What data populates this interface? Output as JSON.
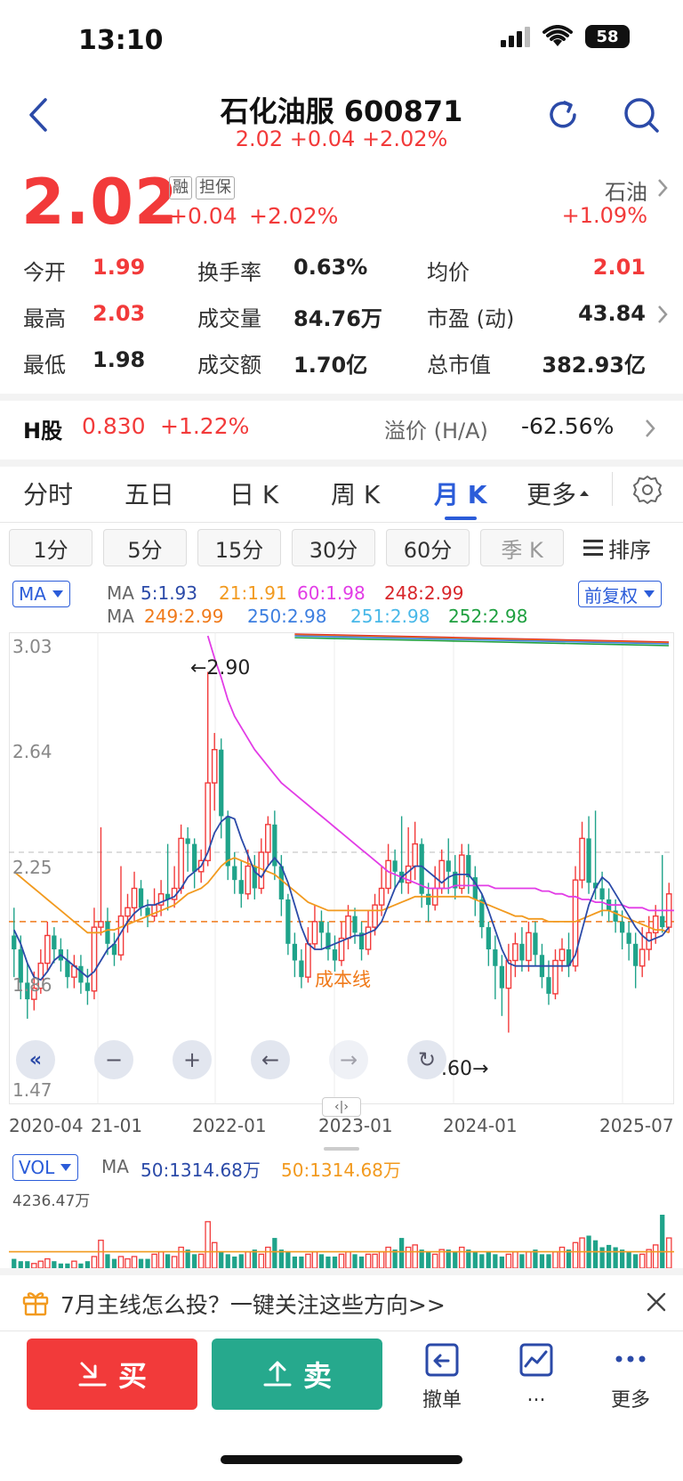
{
  "status_bar": {
    "time": "13:10",
    "battery": "58"
  },
  "header": {
    "title": "石化油服 600871",
    "subtitle": "2.02 +0.04 +2.02%"
  },
  "quote": {
    "price": "2.02",
    "tag_margin": "融",
    "tag_collateral": "担保",
    "change": "+0.04",
    "change_pct": "+2.02%",
    "sector_name": "石油",
    "sector_change": "+1.09%"
  },
  "stats": {
    "open_label": "今开",
    "open": "1.99",
    "turnover_label": "换手率",
    "turnover": "0.63%",
    "avg_label": "均价",
    "avg": "2.01",
    "high_label": "最高",
    "high": "2.03",
    "volume_label": "成交量",
    "volume": "84.76万",
    "pe_label": "市盈 (动)",
    "pe": "43.84",
    "low_label": "最低",
    "low": "1.98",
    "amount_label": "成交额",
    "amount": "1.70亿",
    "mcap_label": "总市值",
    "mcap": "382.93亿"
  },
  "hshare": {
    "label": "H股",
    "price": "0.830",
    "change_pct": "+1.22%",
    "premium_label": "溢价 (H/A)",
    "premium": "-62.56%"
  },
  "tabs": [
    "分时",
    "五日",
    "日 K",
    "周 K",
    "月 K",
    "更多"
  ],
  "active_tab": "月 K",
  "intervals": [
    "1分",
    "5分",
    "15分",
    "30分",
    "60分",
    "季 K",
    "排序"
  ],
  "ma_panel": {
    "selector": "MA",
    "right_selector": "前复权",
    "line1": {
      "prefix": "MA",
      "ma5": "5:1.93",
      "ma21": "21:1.91",
      "ma60": "60:1.98",
      "ma248": "248:2.99"
    },
    "line2": {
      "prefix": "MA",
      "ma249": "249:2.99",
      "ma250": "250:2.98",
      "ma251": "251:2.98",
      "ma252": "252:2.98"
    },
    "colors": {
      "ma5": "#2b4aa8",
      "ma21": "#f29a1f",
      "ma60": "#e23ce6",
      "ma248": "#d8262a",
      "ma249": "#f07a1a",
      "ma250": "#3d7fe0",
      "ma251": "#48b8e8",
      "ma252": "#1fa040"
    }
  },
  "vol_panel": {
    "selector": "VOL",
    "prefix": "MA",
    "ma50_blue": "50:1314.68万",
    "ma50_orange": "50:1314.68万",
    "max_label": "4236.47万"
  },
  "chart_data": {
    "type": "candlestick",
    "y_ticks": [
      "3.03",
      "2.64",
      "2.25",
      "1.86",
      "1.47"
    ],
    "ylim": [
      1.47,
      3.03
    ],
    "x_ticks": [
      "2020-04",
      "21-01",
      "2022-01",
      "2023-01",
      "2024-01",
      "2025-07"
    ],
    "cost_line_label": "成本线",
    "cost_line_value": 2.0,
    "dashed_line_value": 2.25,
    "max_annotation": "←2.90",
    "min_annotation": "1.60→",
    "max_value": 2.9,
    "min_value": 1.6,
    "candles": [
      [
        1.95,
        1.9,
        2.05,
        1.8
      ],
      [
        1.9,
        1.78,
        1.95,
        1.72
      ],
      [
        1.78,
        1.72,
        1.85,
        1.65
      ],
      [
        1.72,
        1.76,
        1.82,
        1.68
      ],
      [
        1.76,
        1.85,
        1.9,
        1.74
      ],
      [
        1.85,
        1.95,
        2.0,
        1.82
      ],
      [
        1.95,
        1.9,
        1.98,
        1.85
      ],
      [
        1.9,
        1.86,
        1.94,
        1.82
      ],
      [
        1.86,
        1.8,
        1.9,
        1.76
      ],
      [
        1.8,
        1.84,
        1.88,
        1.76
      ],
      [
        1.84,
        1.78,
        1.88,
        1.74
      ],
      [
        1.78,
        1.75,
        1.83,
        1.7
      ],
      [
        1.75,
        1.98,
        2.05,
        1.72
      ],
      [
        1.98,
        2.0,
        2.34,
        1.95
      ],
      [
        2.0,
        1.92,
        2.05,
        1.88
      ],
      [
        1.92,
        1.88,
        1.96,
        1.84
      ],
      [
        1.88,
        2.02,
        2.2,
        1.86
      ],
      [
        2.02,
        2.05,
        2.1,
        1.96
      ],
      [
        2.05,
        2.12,
        2.18,
        2.0
      ],
      [
        2.12,
        2.05,
        2.15,
        2.02
      ],
      [
        2.05,
        2.02,
        2.08,
        1.98
      ],
      [
        2.02,
        2.06,
        2.12,
        2.0
      ],
      [
        2.06,
        2.1,
        2.15,
        2.02
      ],
      [
        2.1,
        2.08,
        2.28,
        2.04
      ],
      [
        2.08,
        2.12,
        2.2,
        2.05
      ],
      [
        2.12,
        2.3,
        2.35,
        2.1
      ],
      [
        2.3,
        2.28,
        2.34,
        2.18
      ],
      [
        2.28,
        2.18,
        2.3,
        2.12
      ],
      [
        2.18,
        2.22,
        2.26,
        2.14
      ],
      [
        2.22,
        2.5,
        2.9,
        2.2
      ],
      [
        2.5,
        2.62,
        2.68,
        2.4
      ],
      [
        2.62,
        2.38,
        2.66,
        2.3
      ],
      [
        2.38,
        2.2,
        2.4,
        2.15
      ],
      [
        2.2,
        2.15,
        2.25,
        2.1
      ],
      [
        2.15,
        2.1,
        2.22,
        2.05
      ],
      [
        2.1,
        2.2,
        2.26,
        2.08
      ],
      [
        2.2,
        2.12,
        2.24,
        2.08
      ],
      [
        2.12,
        2.25,
        2.3,
        2.1
      ],
      [
        2.25,
        2.35,
        2.38,
        2.2
      ],
      [
        2.35,
        2.2,
        2.4,
        2.15
      ],
      [
        2.2,
        2.08,
        2.24,
        2.02
      ],
      [
        2.08,
        1.92,
        2.1,
        1.88
      ],
      [
        1.92,
        1.86,
        1.96,
        1.8
      ],
      [
        1.86,
        1.8,
        1.9,
        1.76
      ],
      [
        1.8,
        1.92,
        1.98,
        1.78
      ],
      [
        1.92,
        2.0,
        2.06,
        1.9
      ],
      [
        2.0,
        1.96,
        2.04,
        1.9
      ],
      [
        1.96,
        1.9,
        2.0,
        1.86
      ],
      [
        1.9,
        1.86,
        1.95,
        1.82
      ],
      [
        1.86,
        1.94,
        2.0,
        1.84
      ],
      [
        1.94,
        2.02,
        2.06,
        1.9
      ],
      [
        2.02,
        1.96,
        2.05,
        1.92
      ],
      [
        1.96,
        1.9,
        2.0,
        1.86
      ],
      [
        1.9,
        1.98,
        2.04,
        1.88
      ],
      [
        1.98,
        2.06,
        2.1,
        1.95
      ],
      [
        2.06,
        2.12,
        2.2,
        2.02
      ],
      [
        2.12,
        2.22,
        2.28,
        2.1
      ],
      [
        2.22,
        2.18,
        2.26,
        2.12
      ],
      [
        2.18,
        2.14,
        2.38,
        2.1
      ],
      [
        2.14,
        2.2,
        2.34,
        2.1
      ],
      [
        2.2,
        2.28,
        2.36,
        2.15
      ],
      [
        2.28,
        2.1,
        2.3,
        2.05
      ],
      [
        2.1,
        2.06,
        2.14,
        2.0
      ],
      [
        2.06,
        2.12,
        2.2,
        2.04
      ],
      [
        2.12,
        2.22,
        2.26,
        2.1
      ],
      [
        2.22,
        2.18,
        2.3,
        2.1
      ],
      [
        2.18,
        2.12,
        2.24,
        2.08
      ],
      [
        2.12,
        2.24,
        2.28,
        2.1
      ],
      [
        2.24,
        2.16,
        2.28,
        2.1
      ],
      [
        2.16,
        2.08,
        2.2,
        2.02
      ],
      [
        2.08,
        1.98,
        2.1,
        1.94
      ],
      [
        1.98,
        1.9,
        2.0,
        1.84
      ],
      [
        1.9,
        1.84,
        1.95,
        1.72
      ],
      [
        1.84,
        1.76,
        1.88,
        1.66
      ],
      [
        1.76,
        1.86,
        1.92,
        1.6
      ],
      [
        1.86,
        1.92,
        1.96,
        1.8
      ],
      [
        1.92,
        1.86,
        1.98,
        1.82
      ],
      [
        1.86,
        1.96,
        2.0,
        1.82
      ],
      [
        1.96,
        1.88,
        2.0,
        1.84
      ],
      [
        1.88,
        1.8,
        1.92,
        1.76
      ],
      [
        1.8,
        1.74,
        1.86,
        1.7
      ],
      [
        1.74,
        1.86,
        1.9,
        1.72
      ],
      [
        1.86,
        1.9,
        1.94,
        1.82
      ],
      [
        1.9,
        1.84,
        1.96,
        1.8
      ],
      [
        1.84,
        2.15,
        2.2,
        1.82
      ],
      [
        2.15,
        2.3,
        2.36,
        2.12
      ],
      [
        2.3,
        2.14,
        2.38,
        2.1
      ],
      [
        2.14,
        2.12,
        2.4,
        2.08
      ],
      [
        2.12,
        2.08,
        2.18,
        2.02
      ],
      [
        2.08,
        2.04,
        2.12,
        2.0
      ],
      [
        2.04,
        2.0,
        2.08,
        1.96
      ],
      [
        2.0,
        1.96,
        2.04,
        1.9
      ],
      [
        1.96,
        1.92,
        2.0,
        1.86
      ],
      [
        1.92,
        1.84,
        1.96,
        1.76
      ],
      [
        1.84,
        1.9,
        1.98,
        1.8
      ],
      [
        1.9,
        1.96,
        2.02,
        1.86
      ],
      [
        1.96,
        2.02,
        2.06,
        1.92
      ],
      [
        2.02,
        1.98,
        2.24,
        1.96
      ],
      [
        1.98,
        2.1,
        2.14,
        1.96
      ]
    ],
    "ma5": [
      1.97,
      1.92,
      1.85,
      1.8,
      1.79,
      1.82,
      1.86,
      1.88,
      1.86,
      1.84,
      1.82,
      1.8,
      1.82,
      1.86,
      1.9,
      1.92,
      1.96,
      2.0,
      2.03,
      2.05,
      2.06,
      2.06,
      2.07,
      2.08,
      2.09,
      2.12,
      2.16,
      2.18,
      2.2,
      2.25,
      2.32,
      2.36,
      2.38,
      2.37,
      2.3,
      2.24,
      2.18,
      2.16,
      2.2,
      2.23,
      2.2,
      2.14,
      2.06,
      1.98,
      1.92,
      1.9,
      1.9,
      1.91,
      1.92,
      1.93,
      1.94,
      1.95,
      1.95,
      1.96,
      1.97,
      2.0,
      2.06,
      2.12,
      2.16,
      2.18,
      2.2,
      2.2,
      2.18,
      2.16,
      2.14,
      2.16,
      2.17,
      2.17,
      2.17,
      2.14,
      2.1,
      2.04,
      1.97,
      1.9,
      1.85,
      1.84,
      1.84,
      1.84,
      1.84,
      1.84,
      1.84,
      1.84,
      1.84,
      1.84,
      1.88,
      1.97,
      2.06,
      2.12,
      2.16,
      2.14,
      2.1,
      2.06,
      2.02,
      1.98,
      1.95,
      1.93,
      1.94,
      1.95,
      1.98
    ],
    "ma21": [
      2.18,
      2.16,
      2.14,
      2.12,
      2.1,
      2.08,
      2.06,
      2.04,
      2.02,
      2.0,
      1.98,
      1.96,
      1.96,
      1.96,
      1.97,
      1.97,
      1.98,
      1.99,
      2.0,
      2.01,
      2.02,
      2.03,
      2.04,
      2.05,
      2.06,
      2.08,
      2.1,
      2.11,
      2.12,
      2.14,
      2.17,
      2.2,
      2.22,
      2.23,
      2.22,
      2.21,
      2.2,
      2.19,
      2.18,
      2.17,
      2.15,
      2.13,
      2.11,
      2.09,
      2.07,
      2.06,
      2.05,
      2.04,
      2.04,
      2.04,
      2.04,
      2.04,
      2.04,
      2.04,
      2.04,
      2.04,
      2.05,
      2.06,
      2.07,
      2.08,
      2.09,
      2.09,
      2.09,
      2.09,
      2.09,
      2.09,
      2.09,
      2.09,
      2.09,
      2.08,
      2.07,
      2.06,
      2.05,
      2.04,
      2.03,
      2.02,
      2.02,
      2.01,
      2.01,
      2.01,
      2.0,
      2.0,
      2.0,
      2.0,
      2.0,
      2.01,
      2.02,
      2.03,
      2.04,
      2.04,
      2.03,
      2.02,
      2.01,
      2.0,
      1.99,
      1.98,
      1.97,
      1.97,
      1.96
    ],
    "ma60_start": 29,
    "ma60": [
      3.03,
      2.95,
      2.88,
      2.8,
      2.74,
      2.7,
      2.66,
      2.62,
      2.59,
      2.56,
      2.53,
      2.5,
      2.48,
      2.46,
      2.44,
      2.42,
      2.4,
      2.38,
      2.36,
      2.34,
      2.32,
      2.3,
      2.28,
      2.26,
      2.24,
      2.22,
      2.2,
      2.18,
      2.17,
      2.16,
      2.15,
      2.14,
      2.13,
      2.12,
      2.12,
      2.12,
      2.12,
      2.13,
      2.13,
      2.13,
      2.13,
      2.13,
      2.13,
      2.12,
      2.12,
      2.12,
      2.12,
      2.12,
      2.12,
      2.12,
      2.11,
      2.11,
      2.1,
      2.1,
      2.09,
      2.09,
      2.08,
      2.08,
      2.07,
      2.07,
      2.06,
      2.06,
      2.06,
      2.05,
      2.05,
      2.05,
      2.04,
      2.04,
      2.04,
      2.04,
      2.04
    ]
  },
  "volumes": [
    4,
    3,
    3,
    2,
    3,
    4,
    3,
    2,
    2,
    3,
    2,
    3,
    5,
    12,
    6,
    4,
    5,
    4,
    5,
    4,
    4,
    6,
    7,
    6,
    5,
    9,
    8,
    6,
    6,
    20,
    11,
    7,
    6,
    5,
    6,
    7,
    8,
    6,
    9,
    13,
    8,
    7,
    5,
    5,
    6,
    7,
    6,
    5,
    5,
    6,
    7,
    6,
    5,
    6,
    6,
    7,
    9,
    8,
    13,
    9,
    10,
    8,
    7,
    6,
    8,
    8,
    7,
    9,
    8,
    7,
    6,
    7,
    6,
    5,
    6,
    7,
    6,
    7,
    8,
    6,
    6,
    7,
    9,
    8,
    11,
    13,
    14,
    12,
    9,
    10,
    9,
    8,
    7,
    6,
    6,
    8,
    10,
    23,
    13
  ],
  "banner": {
    "text": "7月主线怎么投？一键关注这些方向>>"
  },
  "actions": {
    "buy": "买",
    "sell": "卖",
    "cancel": "撤单",
    "more_dots": "...",
    "more": "更多"
  }
}
